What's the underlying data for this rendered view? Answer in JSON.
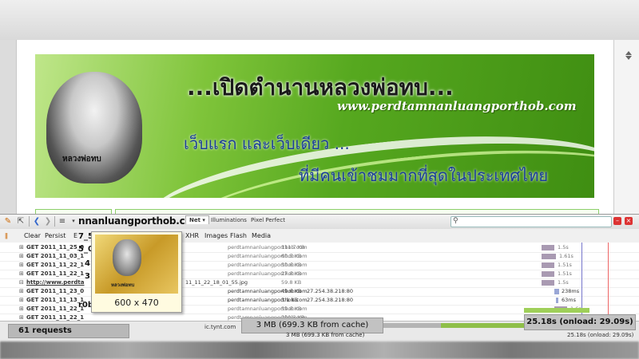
{
  "banner": {
    "title": "...เปิดตำนานหลวงพ่อทบ...",
    "url": "www.perdtamnanluangporthob.com",
    "line1": "เว็บแรก และเว็บเดียว ...",
    "line2": "ที่มีคนเข้าชมมากที่สุดในประเทศไทย",
    "portrait_caption": "หลวงพ่อทบ"
  },
  "toolbar": {
    "url_fragment": "nnanluangporthob.com",
    "tabs": [
      "Net",
      "Illuminations",
      "Pixel Perfect"
    ],
    "net_dropdown": "▾"
  },
  "filters": [
    "Clear",
    "Persist",
    "E",
    "XHR",
    "Images",
    "Flash",
    "Media"
  ],
  "requests": [
    {
      "req": "GET 2011_11_25_0",
      "domain": "perdtamnanluangporthob.com",
      "size": "111.7 KB",
      "ip": "",
      "time": "1.5s"
    },
    {
      "req": "GET 2011_11_03_1",
      "domain": "perdtamnanluangporthob.com",
      "size": "60.5 KB",
      "ip": "",
      "time": "1.61s"
    },
    {
      "req": "GET 2011_11_22_1",
      "domain": "perdtamnanluangporthob.com",
      "size": "50.6 KB",
      "ip": "",
      "time": "1.51s"
    },
    {
      "req": "GET 2011_11_22_1",
      "domain": "perdtamnanluangporthob.com",
      "size": "27.8 KB",
      "ip": "",
      "time": "1.51s"
    },
    {
      "req": "http://www.perdta",
      "domain": "11_11_22_18_01_55.jpg",
      "size": "59.8 KB",
      "ip": "",
      "time": "1.5s"
    },
    {
      "req": "GET 2011_11_23_0",
      "domain": "perdtamnanluangporthob.com",
      "size": "49.6 KB",
      "ip": "27.254.38.218:80",
      "time": "238ms"
    },
    {
      "req": "GET 2011_11_13_1",
      "domain": "perdtamnanluangporthob.com",
      "size": "3.1 KB",
      "ip": "27.254.38.218:80",
      "time": "63ms"
    },
    {
      "req": "GET 2011_11_22_1",
      "domain": "perdtamnanluangporthob.com",
      "size": "59.8 KB",
      "ip": "",
      "time": "1.6s"
    },
    {
      "req": "GET 2011_11_22_1",
      "domain": "perdtamnanluangporthob.com",
      "size": "200.3 KB",
      "ip": "",
      "time": ""
    }
  ],
  "tooltip": {
    "dimensions": "600 x 470",
    "caption": "หลวงพ่อทบ"
  },
  "fragments": {
    "f1": "7_5",
    "f2": "5_0",
    "f3": "4",
    "f4": "3",
    "f5": "r0b"
  },
  "summary": {
    "requests": "61 requests",
    "size_big": "3 MB   (699.3 KB from cache)",
    "size_small": "3 MB    (699.3 KB from cache)",
    "time_big": "25.18s (onload: 29.09s)",
    "time_small": "25.18s (onload: 29.09s)",
    "domain": "ic.tynt.com"
  }
}
